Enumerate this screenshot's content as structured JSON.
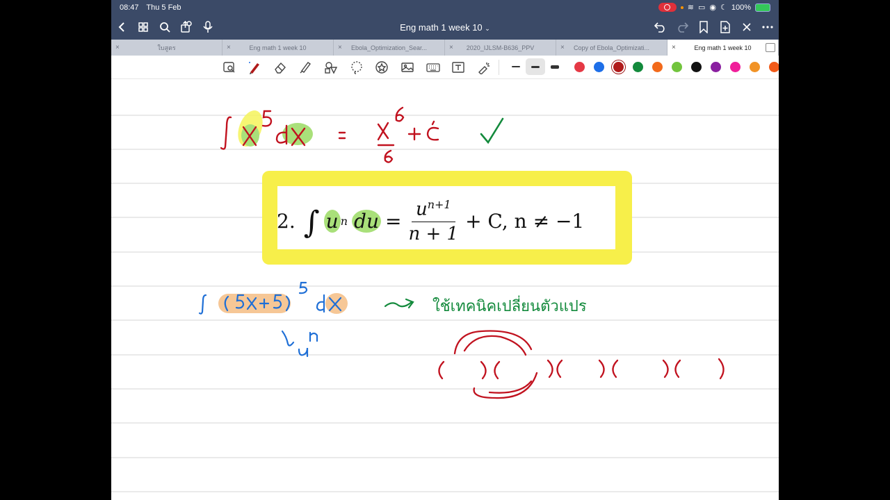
{
  "status": {
    "time": "08:47",
    "date": "Thu 5 Feb",
    "battery": "100%"
  },
  "document": {
    "title": "Eng math 1 week 10",
    "title_caret": "⌄"
  },
  "tabs": [
    {
      "label": "ใบสูตร",
      "active": false
    },
    {
      "label": "Eng math 1 week 10",
      "active": false
    },
    {
      "label": "Ebola_Optimization_Sear...",
      "active": false
    },
    {
      "label": "2020_IJLSM-B636_PPV",
      "active": false
    },
    {
      "label": "Copy of Ebola_Optimizati...",
      "active": false
    },
    {
      "label": "Eng math 1 week 10",
      "active": true
    }
  ],
  "icons": {
    "back": "chevron-left-icon",
    "grid": "grid-icon",
    "search": "search-icon",
    "share": "share-icon",
    "mic": "microphone-icon",
    "undo": "undo-icon",
    "redo": "redo-icon",
    "bookmark": "bookmark-icon",
    "add_page": "add-page-icon",
    "close": "close-icon",
    "more": "more-icon"
  },
  "tools": [
    "lasso-zoom",
    "pen",
    "eraser",
    "highlighter",
    "shapes",
    "lasso",
    "sticker",
    "image",
    "keyboard",
    "text",
    "laser"
  ],
  "palette": [
    "#e53945",
    "#1e6fe8",
    "#b01a1a",
    "#138a3c",
    "#f26a1b",
    "#72c43d",
    "#111111",
    "#8a1fa0",
    "#f01e9a",
    "#f19326",
    "#f25a18"
  ],
  "selected_color": "#b01a1a",
  "ink": {
    "red": "#c1121f",
    "green": "#138a3c",
    "blue": "#1f6fd6",
    "hl_yellow": "#f4f35a",
    "hl_green": "#a9e07a",
    "hl_orange": "#f6c796"
  },
  "formula": {
    "number": "2.",
    "integral": "∫",
    "u": "u",
    "n": "n",
    "du": "du",
    "equals": "=",
    "numerator_base": "u",
    "numerator_exp": "n+1",
    "denominator": "n + 1",
    "tail": "+ C,  n ≠ −1"
  },
  "handwriting": {
    "thai_note": "ใช้เทคนิคเปลี่ยนตัวแปร"
  }
}
